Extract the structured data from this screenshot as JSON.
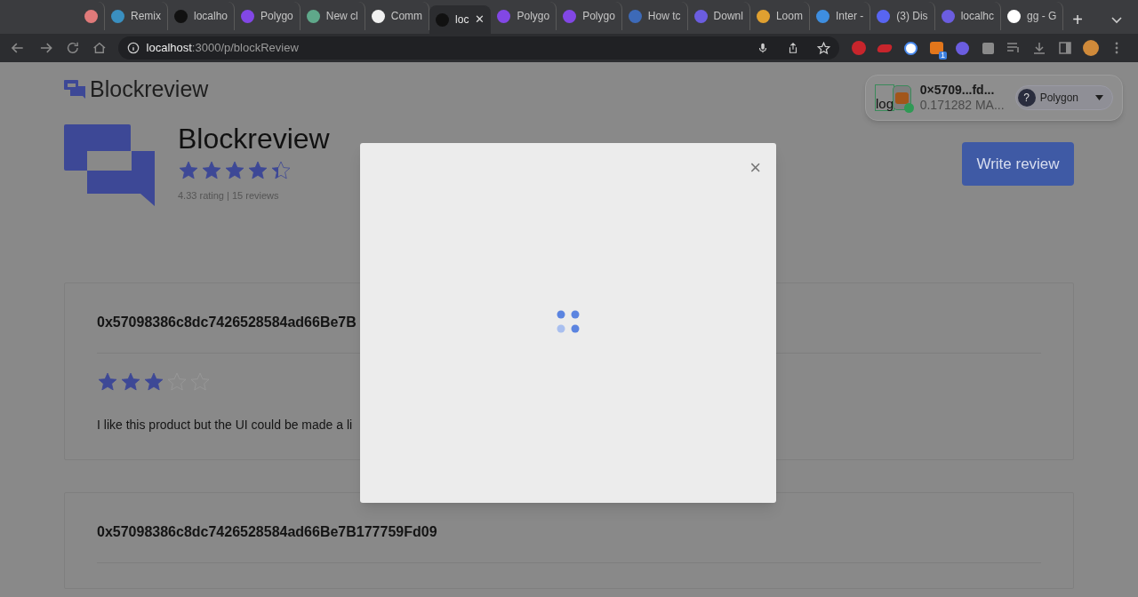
{
  "browser": {
    "tabs": [
      {
        "color": "#e07a7a",
        "selected": false
      },
      {
        "label": "Remix",
        "color": "#3a8fc0",
        "selected": false
      },
      {
        "label": "localho",
        "color": "#111111",
        "selected": false
      },
      {
        "label": "Polygo",
        "color": "#8247e5",
        "selected": false
      },
      {
        "label": "New cl",
        "color": "#5fa88a",
        "selected": false
      },
      {
        "label": "Comm",
        "color": "#f0f0f0",
        "selected": false
      },
      {
        "label": "loc",
        "color": "#111111",
        "selected": true,
        "close": "✕"
      },
      {
        "label": "Polygo",
        "color": "#8247e5",
        "selected": false
      },
      {
        "label": "Polygo",
        "color": "#8247e5",
        "selected": false
      },
      {
        "label": "How tc",
        "color": "#3d6ab8",
        "selected": false
      },
      {
        "label": "Downl",
        "color": "#6b5de0",
        "selected": false
      },
      {
        "label": "Loom",
        "color": "#e0a030",
        "selected": false
      },
      {
        "label": "Inter -",
        "color": "#3e8ee0",
        "selected": false
      },
      {
        "label": "(3) Dis",
        "color": "#5865f2",
        "selected": false
      },
      {
        "label": "localhc",
        "color": "#6b5de0",
        "selected": false
      },
      {
        "label": "gg - G",
        "color": "#ffffff",
        "selected": false
      }
    ],
    "new_tab": "+",
    "address": {
      "host": "localhost",
      "path": ":3000/p/blockReview"
    },
    "extension_badge": "1"
  },
  "page": {
    "brand": "Blockreview",
    "wallet": {
      "image_alt": "log",
      "address": "0×5709...fd...",
      "balance": "0.171282 MA...",
      "network_icon": "?",
      "network": "Polygon"
    },
    "product": {
      "name": "Blockreview",
      "stars": 4.33,
      "summary": "4.33 rating | 15 reviews"
    },
    "write_review": "Write review",
    "reviews": [
      {
        "author": "0x57098386c8dc7426528584ad66Be7B",
        "stars": 3,
        "text": "I like this product but the UI could be made a li"
      },
      {
        "author": "0x57098386c8dc7426528584ad66Be7B177759Fd09"
      }
    ]
  },
  "modal": {
    "close": "×",
    "loading": true
  }
}
